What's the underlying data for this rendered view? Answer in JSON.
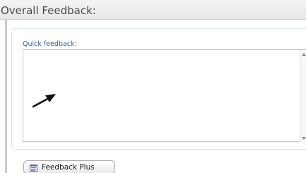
{
  "header": {
    "title": "Overall Feedback:"
  },
  "quick_feedback": {
    "label": "Quick feedback:",
    "value": "",
    "placeholder": ""
  },
  "feedback_plus_button": {
    "label": "Feedback Plus",
    "icon": "feedback-plus-icon"
  },
  "pointer": {
    "icon": "arrow-cursor-icon"
  },
  "colors": {
    "label_blue": "#2a5f9c",
    "border_blue": "#b9c7d6",
    "header_text": "#4a4a4a"
  }
}
